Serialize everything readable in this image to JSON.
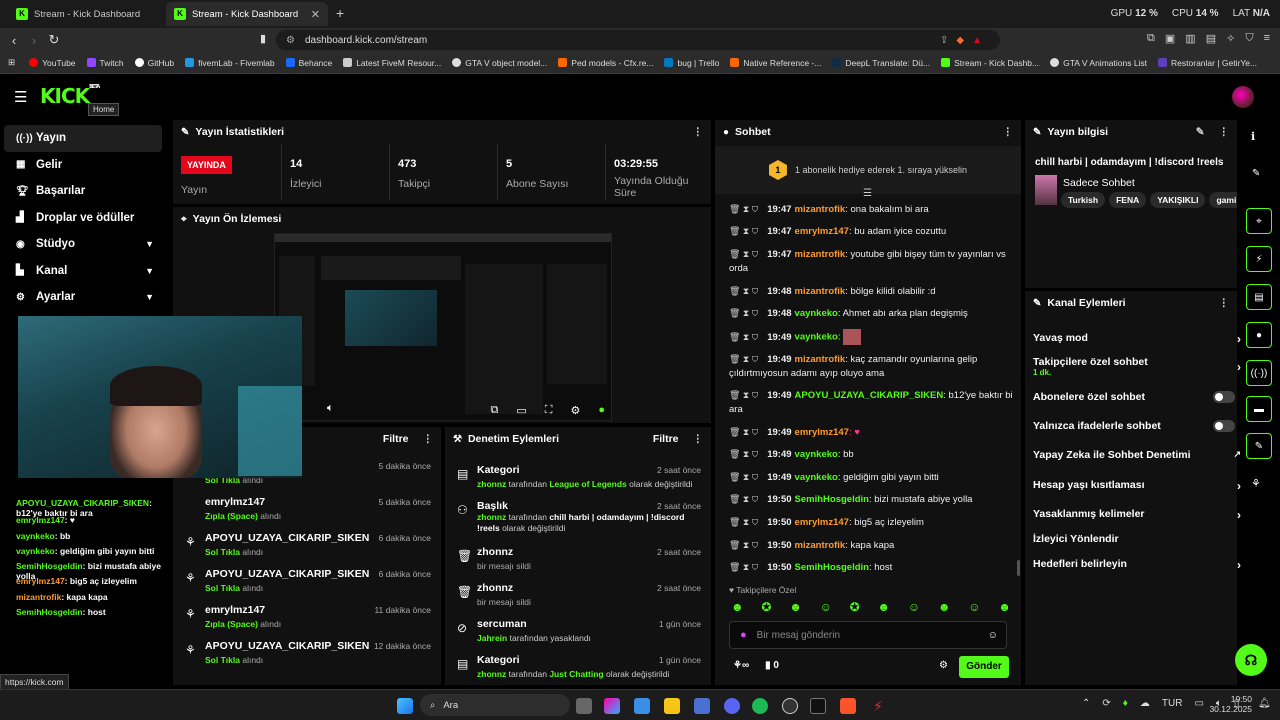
{
  "browser": {
    "tabs": [
      {
        "title": "Stream - Kick Dashboard",
        "active": false
      },
      {
        "title": "Stream - Kick Dashboard",
        "active": true
      }
    ],
    "meters": [
      {
        "label": "GPU",
        "value": "12 %"
      },
      {
        "label": "CPU",
        "value": "14 %"
      },
      {
        "label": "LAT",
        "value": "N/A"
      }
    ],
    "url": "dashboard.kick.com/stream",
    "bookmarks": [
      "YouTube",
      "Twitch",
      "GitHub",
      "fivemLab - Fivemlab",
      "Behance",
      "Latest FiveM Resour...",
      "GTA V object model...",
      "Ped models - Cfx.re...",
      "bug | Trello",
      "Native Reference -...",
      "DeepL Translate: Dü...",
      "Stream - Kick Dashb...",
      "GTA V Animations List",
      "Restoranlar | GetirYe..."
    ]
  },
  "header": {
    "logo": "KICK",
    "logo_sup": "BETA",
    "tooltip": "Home"
  },
  "sidebar": {
    "items": [
      {
        "label": "Yayın",
        "active": true
      },
      {
        "label": "Gelir"
      },
      {
        "label": "Başarılar"
      },
      {
        "label": "Droplar ve ödüller"
      },
      {
        "label": "Stüdyo",
        "chevron": true
      },
      {
        "label": "Kanal",
        "chevron": true
      },
      {
        "label": "Ayarlar",
        "chevron": true
      }
    ]
  },
  "stats": {
    "title": "Yayın İstatistikleri",
    "live_badge": "YAYINDA",
    "status_label": "Yayın",
    "items": [
      {
        "value": "14",
        "label": "İzleyici"
      },
      {
        "value": "473",
        "label": "Takipçi"
      },
      {
        "value": "5",
        "label": "Abone Sayısı"
      },
      {
        "value": "03:29:55",
        "label": "Yayında Olduğu Süre"
      }
    ]
  },
  "preview": {
    "title": "Yayın Ön İzlemesi"
  },
  "activity": {
    "filter": "Filtre",
    "rows": [
      {
        "title": "",
        "sub": "Sol Tıkla",
        "suffix": "alındı",
        "time": "5 dakika önce"
      },
      {
        "title": "emrylmz147",
        "sub": "Zıpla (Space)",
        "suffix": "alındı",
        "time": "5 dakika önce"
      },
      {
        "title": "APOYU_UZAYA_CIKARIP_SIKEN",
        "sub": "Sol Tıkla",
        "suffix": "alındı",
        "time": "6 dakika önce"
      },
      {
        "title": "APOYU_UZAYA_CIKARIP_SIKEN",
        "sub": "Sol Tıkla",
        "suffix": "alındı",
        "time": "6 dakika önce"
      },
      {
        "title": "emrylmz147",
        "sub": "Zıpla (Space)",
        "suffix": "alındı",
        "time": "11 dakika önce"
      },
      {
        "title": "APOYU_UZAYA_CIKARIP_SIKEN",
        "sub": "Sol Tıkla",
        "suffix": "alındı",
        "time": "12 dakika önce"
      }
    ]
  },
  "moderation": {
    "title": "Denetim Eylemleri",
    "filter": "Filtre",
    "rows": [
      {
        "title": "Kategori",
        "user": "zhonnz",
        "mid": "tarafından",
        "val": "League of Legends",
        "tail": "olarak değiştirildi",
        "time": "2 saat önce"
      },
      {
        "title": "Başlık",
        "user": "zhonnz",
        "mid": "tarafından",
        "val": "chill harbi | odamdayım | !discord !reels",
        "tail": "olarak değiştirildi",
        "time": "2 saat önce"
      },
      {
        "title": "zhonnz",
        "user": "",
        "mid": "bir mesajı sildi",
        "val": "",
        "tail": "",
        "time": "2 saat önce"
      },
      {
        "title": "zhonnz",
        "user": "",
        "mid": "bir mesajı sildi",
        "val": "",
        "tail": "",
        "time": "2 saat önce"
      },
      {
        "title": "sercuman",
        "user": "Jahrein",
        "mid": "tarafından yasaklandı",
        "val": "",
        "tail": "",
        "time": "1 gün önce"
      },
      {
        "title": "Kategori",
        "user": "zhonnz",
        "mid": "tarafından",
        "val": "Just Chatting",
        "tail": "olarak değiştirildi",
        "time": "1 gün önce"
      }
    ]
  },
  "chat": {
    "title": "Sohbet",
    "pinned": "1 abonelik hediye ederek 1. sıraya yükselin",
    "pinned_rank": "1",
    "messages": [
      {
        "time": "19:47",
        "user": "mizantrofik",
        "color": "#ff9b2f",
        "text": ": ona bakalım bi ara"
      },
      {
        "time": "19:47",
        "user": "emrylmz147",
        "color": "#ff9b2f",
        "text": ": bu adam iyice cozuttu"
      },
      {
        "time": "19:47",
        "user": "mizantrofik",
        "color": "#ff9b2f",
        "text": ": youtube gibi bişey tüm tv yayınları vs orda"
      },
      {
        "time": "19:48",
        "user": "mizantrofik",
        "color": "#ff9b2f",
        "text": ": bölge kilidi olabilir :d"
      },
      {
        "time": "19:48",
        "user": "vaynkeko",
        "color": "#53fc18",
        "text": ": Ahmet abı arka plan degişmiş"
      },
      {
        "time": "19:49",
        "user": "vaynkeko",
        "color": "#53fc18",
        "text": ":"
      },
      {
        "time": "19:49",
        "user": "mizantrofik",
        "color": "#ff9b2f",
        "text": ": kaç zamandır oyunlarına gelip çıldırtmıyosun adamı ayıp oluyo ama"
      },
      {
        "time": "19:49",
        "user": "APOYU_UZAYA_CIKARIP_SIKEN",
        "color": "#53fc18",
        "text": ": b12'ye baktır bi ara"
      },
      {
        "time": "19:49",
        "user": "emrylmz147",
        "color": "#ff9b2f",
        "text": ": ♥"
      },
      {
        "time": "19:49",
        "user": "vaynkeko",
        "color": "#53fc18",
        "text": ": bb"
      },
      {
        "time": "19:49",
        "user": "vaynkeko",
        "color": "#53fc18",
        "text": ": geldiğim gibi yayın bitti"
      },
      {
        "time": "19:50",
        "user": "SemihHosgeldin",
        "color": "#53fc18",
        "text": ": bizi mustafa abiye yolla"
      },
      {
        "time": "19:50",
        "user": "emrylmz147",
        "color": "#ff9b2f",
        "text": ": big5 aç izleyelim"
      },
      {
        "time": "19:50",
        "user": "mizantrofik",
        "color": "#ff9b2f",
        "text": ": kapa kapa"
      },
      {
        "time": "19:50",
        "user": "SemihHosgeldin",
        "color": "#53fc18",
        "text": ": host"
      }
    ],
    "followers_only": "Takipçilere Özel",
    "input_placeholder": "Bir mesaj gönderin",
    "points": "0",
    "send": "Gönder"
  },
  "mini_chat": [
    {
      "user": "APOYU_UZAYA_CIKARIP_SIKEN",
      "text": ": b12'ye baktır bi ara",
      "color": "#53fc18"
    },
    {
      "user": "emrylmz147",
      "text": ": ♥",
      "color": "#53fc18"
    },
    {
      "user": "vaynkeko",
      "text": ": bb",
      "color": "#53fc18"
    },
    {
      "user": "vaynkeko",
      "text": ": geldiğim gibi yayın bitti",
      "color": "#53fc18"
    },
    {
      "user": "SemihHosgeldin",
      "text": ": bizi mustafa abiye yolla",
      "color": "#53fc18"
    },
    {
      "user": "emrylmz147",
      "text": ": big5 aç izleyelim",
      "color": "#53fc18"
    },
    {
      "user": "mizantrofik",
      "text": ": kapa kapa",
      "color": "#ff9b2f"
    },
    {
      "user": "SemihHosgeldin",
      "text": ": host",
      "color": "#53fc18"
    }
  ],
  "stream_info": {
    "title": "Yayın bilgisi",
    "stream_title": "chill harbi | odamdayım | !discord !reels",
    "category": "Sadece Sohbet",
    "tags": [
      "Turkish",
      "FENA",
      "YAKIŞIKLI",
      "gami"
    ]
  },
  "channel_actions": {
    "title": "Kanal Eylemleri",
    "items": [
      {
        "label": "Yavaş mod",
        "type": "arrow"
      },
      {
        "label": "Takipçilere özel sohbet",
        "sub": "1 dk.",
        "type": "arrow"
      },
      {
        "label": "Abonelere özel sohbet",
        "type": "toggle"
      },
      {
        "label": "Yalnızca ifadelerle sohbet",
        "type": "toggle"
      },
      {
        "label": "Yapay Zeka ile Sohbet Denetimi",
        "type": "ext"
      },
      {
        "label": "Hesap yaşı kısıtlaması",
        "type": "arrow"
      },
      {
        "label": "Yasaklanmış kelimeler",
        "type": "arrow"
      },
      {
        "label": "İzleyici Yönlendir",
        "type": "none"
      },
      {
        "label": "Hedefleri belirleyin",
        "type": "arrow"
      }
    ]
  },
  "status_url": "https://kick.com",
  "taskbar": {
    "search": "Ara",
    "lang": "TUR",
    "time": "19:50",
    "date": "30.12.2025"
  },
  "colors": {
    "accent": "#53fc18",
    "live": "#e2071b",
    "panel": "#111111"
  }
}
